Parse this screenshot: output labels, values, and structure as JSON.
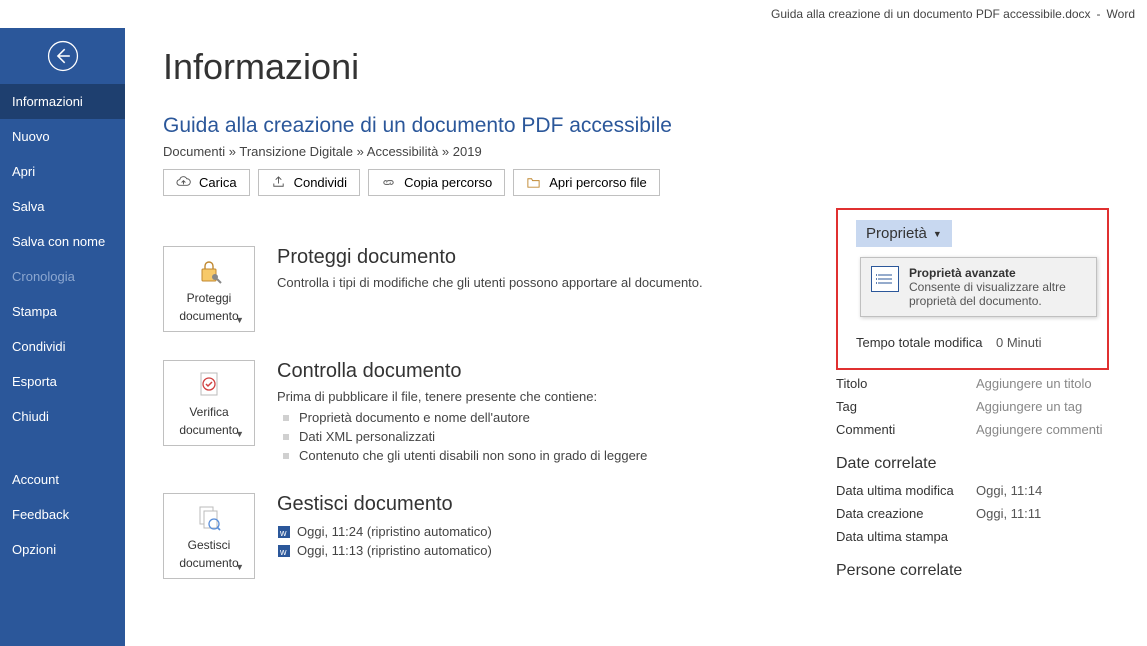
{
  "titlebar": {
    "filename": "Guida alla creazione di un documento PDF accessibile.docx",
    "sep": "-",
    "app": "Word"
  },
  "sidebar": {
    "items": [
      {
        "label": "Informazioni",
        "active": true
      },
      {
        "label": "Nuovo"
      },
      {
        "label": "Apri"
      },
      {
        "label": "Salva"
      },
      {
        "label": "Salva con nome"
      },
      {
        "label": "Cronologia",
        "disabled": true
      },
      {
        "label": "Stampa"
      },
      {
        "label": "Condividi"
      },
      {
        "label": "Esporta"
      },
      {
        "label": "Chiudi"
      }
    ],
    "bottom": [
      {
        "label": "Account"
      },
      {
        "label": "Feedback"
      },
      {
        "label": "Opzioni"
      }
    ]
  },
  "page": {
    "title": "Informazioni",
    "docTitle": "Guida alla creazione di un documento PDF accessibile",
    "breadcrumb": "Documenti » Transizione Digitale » Accessibilità » 2019"
  },
  "buttons": {
    "upload": "Carica",
    "share": "Condividi",
    "copyPath": "Copia percorso",
    "openPath": "Apri percorso file"
  },
  "protect": {
    "btn1": "Proteggi",
    "btn2": "documento",
    "title": "Proteggi documento",
    "desc": "Controlla i tipi di modifiche che gli utenti possono apportare al documento."
  },
  "inspect": {
    "btn1": "Verifica",
    "btn2": "documento",
    "title": "Controlla documento",
    "lead": "Prima di pubblicare il file, tenere presente che contiene:",
    "items": [
      "Proprietà documento e nome dell'autore",
      "Dati XML personalizzati",
      "Contenuto che gli utenti disabili non sono in grado di leggere"
    ]
  },
  "manage": {
    "btn1": "Gestisci",
    "btn2": "documento",
    "title": "Gestisci documento",
    "items": [
      "Oggi, 11:24 (ripristino automatico)",
      "Oggi, 11:13 (ripristino automatico)"
    ]
  },
  "props": {
    "dropdown": "Proprietà",
    "tooltipTitle": "Proprietà avanzate",
    "tooltipDesc": "Consente di visualizzare altre proprietà del documento.",
    "rows": {
      "editTimeLabel": "Tempo totale modifica",
      "editTimeValue": "0 Minuti",
      "titleLabel": "Titolo",
      "titlePlaceholder": "Aggiungere un titolo",
      "tagLabel": "Tag",
      "tagPlaceholder": "Aggiungere un tag",
      "commentsLabel": "Commenti",
      "commentsPlaceholder": "Aggiungere commenti"
    },
    "datesTitle": "Date correlate",
    "dates": {
      "modifiedLabel": "Data ultima modifica",
      "modifiedValue": "Oggi, 11:14",
      "createdLabel": "Data creazione",
      "createdValue": "Oggi, 11:11",
      "printedLabel": "Data ultima stampa"
    },
    "peopleTitle": "Persone correlate"
  }
}
